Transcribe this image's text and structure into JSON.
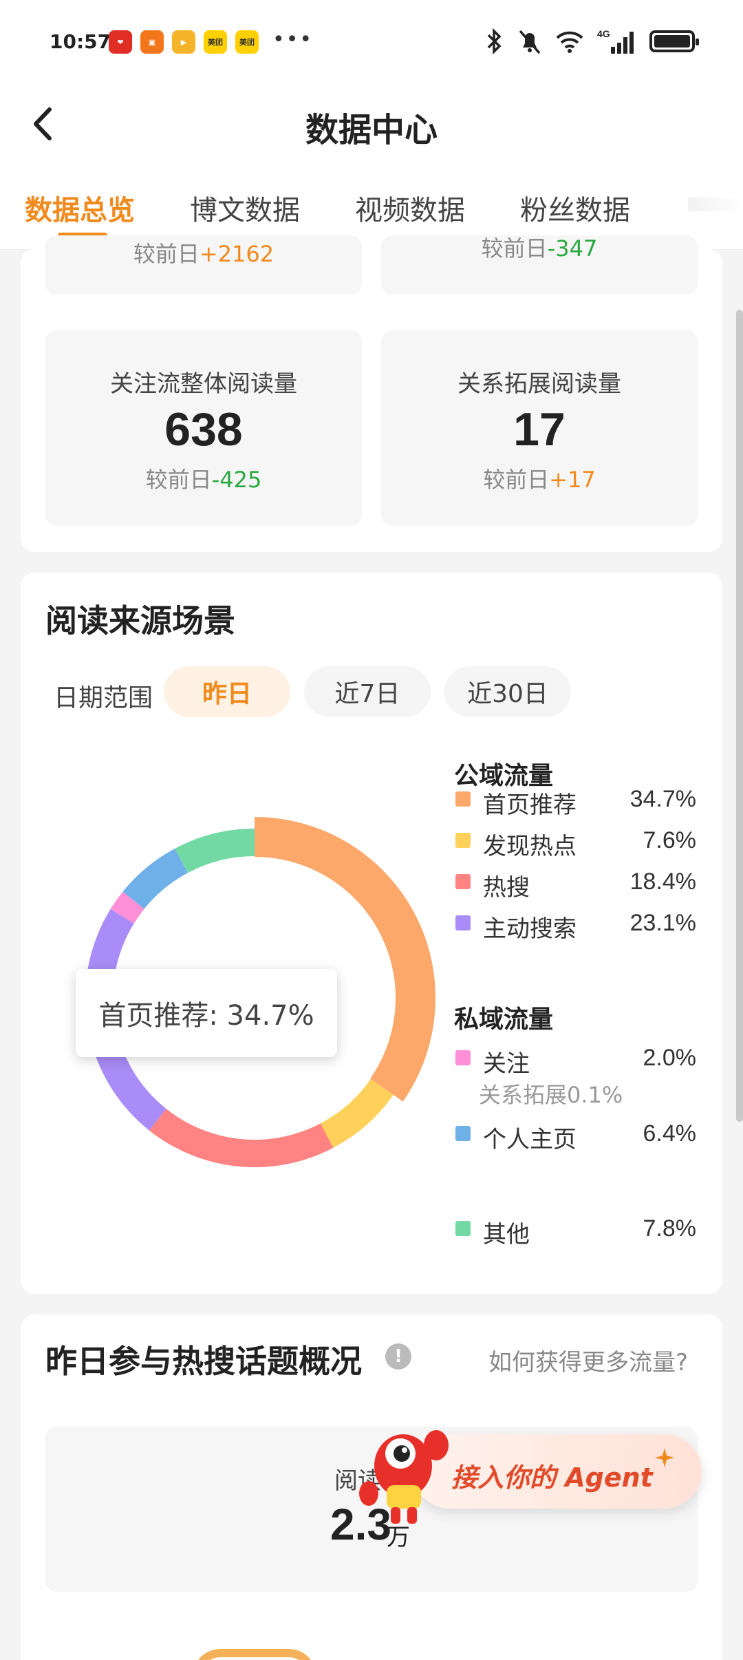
{
  "status_bar": {
    "time": "10:57",
    "apps": [
      {
        "name": "拼多多",
        "color": "#e02e24"
      },
      {
        "name": "红包",
        "color": "#f3761a"
      },
      {
        "name": "视频",
        "color": "#f6b42a"
      },
      {
        "name": "美团",
        "color": "#ffd000"
      },
      {
        "name": "美团",
        "color": "#ffd000"
      }
    ],
    "more": "•••",
    "network": "4G"
  },
  "header": {
    "title": "数据中心"
  },
  "tabs": [
    {
      "label": "数据总览",
      "active": true
    },
    {
      "label": "博文数据",
      "active": false
    },
    {
      "label": "视频数据",
      "active": false
    },
    {
      "label": "粉丝数据",
      "active": false
    }
  ],
  "stats_top_partial": [
    {
      "cmp_prefix": "较前日",
      "cmp_value": "+2162"
    },
    {
      "cmp_prefix": "较前日",
      "cmp_value": "-347"
    }
  ],
  "stats": [
    {
      "label": "关注流整体阅读量",
      "value": "638",
      "cmp_prefix": "较前日",
      "cmp_value": "-425"
    },
    {
      "label": "关系拓展阅读量",
      "value": "17",
      "cmp_prefix": "较前日",
      "cmp_value": "+17"
    }
  ],
  "reading_source": {
    "title": "阅读来源场景",
    "date_range_label": "日期范围",
    "date_options": [
      "昨日",
      "近7日",
      "近30日"
    ],
    "selected_date": "昨日",
    "tooltip": "首页推荐: 34.7%",
    "public_title": "公域流量",
    "private_title": "私域流量",
    "legend_sub": "关系拓展0.1%"
  },
  "chart_data": {
    "type": "pie",
    "categories": [
      "首页推荐",
      "发现热点",
      "热搜",
      "主动搜索",
      "关注",
      "个人主页",
      "其他"
    ],
    "values": [
      34.7,
      7.6,
      18.4,
      23.1,
      2.0,
      6.4,
      7.8
    ],
    "colors": [
      "#fca86a",
      "#ffd05a",
      "#ff8383",
      "#a98cf7",
      "#ff8fd6",
      "#6fb0e8",
      "#72d8a4"
    ],
    "labels": [
      "34.7%",
      "7.6%",
      "18.4%",
      "23.1%",
      "2.0%",
      "6.4%",
      "7.8%"
    ],
    "donut": true,
    "highlighted": "首页推荐"
  },
  "hot_topics": {
    "title": "昨日参与热搜话题概况",
    "more_link": "如何获得更多流量?",
    "read_label": "阅读",
    "read_value": "2.3",
    "read_unit": "万"
  },
  "agent": {
    "label": "接入你的 Agent"
  }
}
